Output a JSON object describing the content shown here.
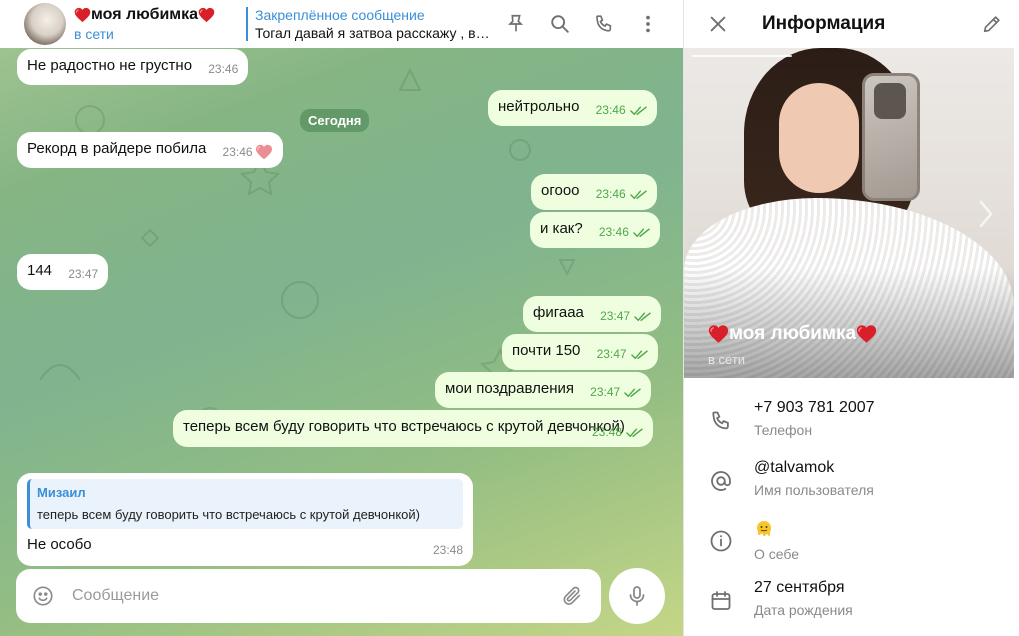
{
  "chat": {
    "contact_name": "моя любимка",
    "status": "в сети",
    "pinned_title": "Закреплённое сообщение",
    "pinned_text": "Тогал давай я затвоа расскажу , в ...",
    "date_divider": "Сегодня",
    "messages": [
      {
        "dir": "in",
        "text": "Не радостно не грустно",
        "time": "23:46"
      },
      {
        "dir": "out",
        "text": "нейтрольно",
        "time": "23:46"
      },
      {
        "dir": "in",
        "text": "Рекорд в райдере побила",
        "time": "23:46",
        "reaction": "heart"
      },
      {
        "dir": "out",
        "text": "огооо",
        "time": "23:46"
      },
      {
        "dir": "out",
        "text": "и как?",
        "time": "23:46"
      },
      {
        "dir": "in",
        "text": "144",
        "time": "23:47"
      },
      {
        "dir": "out",
        "text": "фигааа",
        "time": "23:47"
      },
      {
        "dir": "out",
        "text": "почти 150",
        "time": "23:47"
      },
      {
        "dir": "out",
        "text": "мои поздравления",
        "time": "23:47"
      },
      {
        "dir": "out",
        "text": "теперь всем буду говорить что встречаюсь с крутой девчонкой)",
        "time": "23:48"
      },
      {
        "dir": "in",
        "text": "Не особо",
        "time": "23:48",
        "reply": {
          "author": "Мизаил",
          "text": "теперь всем буду говорить что встречаюсь с крутой девчонкой)"
        }
      }
    ],
    "composer_placeholder": "Сообщение"
  },
  "info": {
    "title": "Информация",
    "name": "моя любимка",
    "status": "в сети",
    "phone": "+7 903 781 2007",
    "phone_label": "Телефон",
    "username": "@talvamok",
    "username_label": "Имя пользователя",
    "bio_label": "О себе",
    "birthday": "27 сентября",
    "birthday_label": "Дата рождения"
  },
  "colors": {
    "accent": "#3a8fd6",
    "outgoing_bubble": "#eefedf",
    "check_green": "#4ea84a",
    "heart_red": "#d91f2a"
  },
  "icons": [
    "pin-icon",
    "search-icon",
    "phone-icon",
    "more-icon",
    "close-icon",
    "edit-icon",
    "emoji-icon",
    "attach-icon",
    "mic-icon",
    "at-icon",
    "info-icon",
    "calendar-icon",
    "double-check-icon",
    "heart-icon"
  ]
}
